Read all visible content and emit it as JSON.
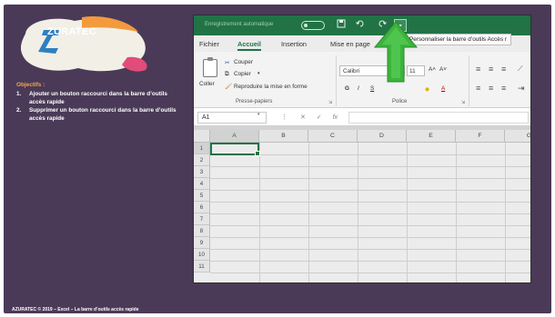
{
  "logo": {
    "brand": "ZURATEC"
  },
  "objectives": {
    "title": "Objectifs :",
    "items": [
      {
        "num": "1.",
        "text": "Ajouter un bouton raccourci dans la barre d’outils accès rapide"
      },
      {
        "num": "2.",
        "text": "Supprimer un bouton raccourci dans la barre d’outils accès rapide"
      }
    ]
  },
  "footer": "AZURATEC © 2019 – Excel – La barre d’outils accès rapide",
  "excel": {
    "titlebar": {
      "autosave": "Enregistrement automatique",
      "qat_save_icon": "save-icon",
      "qat_undo_icon": "undo-icon",
      "qat_redo_icon": "redo-icon",
      "qat_custom_glyph": "▾"
    },
    "tabs": [
      "Fichier",
      "Accueil",
      "Insertion",
      "Mise en page"
    ],
    "active_tab": "Accueil",
    "tooltip": "Personnaliser la barre d’outils Accès r",
    "ribbon": {
      "paste": "Coller",
      "cut": "Couper",
      "copy": "Copier",
      "copy_caret": "▾",
      "format_painter": "Reproduire la mise en forme",
      "clipboard_group": "Presse-papiers",
      "font_name": "Calibri",
      "font_size": "11",
      "font_group": "Police",
      "bold": "G",
      "italic": "I",
      "underline": "S",
      "grow": "A˄",
      "shrink": "A˅",
      "fill": "◆",
      "fontcolor": "A"
    },
    "formula": {
      "name_box": "A1",
      "fx": "fx",
      "cancel": "✕",
      "confirm": "✓"
    },
    "columns": [
      "A",
      "B",
      "C",
      "D",
      "E",
      "F",
      "G"
    ],
    "rows": [
      "1",
      "2",
      "3",
      "4",
      "5",
      "6",
      "7",
      "8",
      "9",
      "10",
      "11"
    ],
    "selected_cell": "A1",
    "accent": "#217346"
  },
  "colors": {
    "panel": "#4a3a58",
    "objectives_title": "#f3a64a",
    "arrow": "#3cb43c"
  }
}
